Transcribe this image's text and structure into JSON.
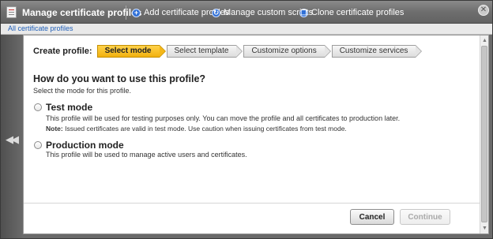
{
  "window": {
    "title": "Manage certificate profiles",
    "actions": [
      {
        "label": "Add certificate profiles",
        "icon": "plus-icon"
      },
      {
        "label": "Manage custom scripts",
        "icon": "refresh-icon"
      },
      {
        "label": "Clone certificate profiles",
        "icon": "copy-icon"
      }
    ]
  },
  "breadcrumb": "All certificate profiles",
  "wizard": {
    "label": "Create profile:",
    "steps": [
      "Select mode",
      "Select template",
      "Customize options",
      "Customize services"
    ],
    "active_step": 0
  },
  "question": "How do you want to use this profile?",
  "subtext": "Select the mode for this profile.",
  "options": [
    {
      "title": "Test mode",
      "description": "This profile will be used for testing purposes only. You can move the profile and all certificates to production later.",
      "note_label": "Note:",
      "note": "Issued certificates are valid in test mode. Use caution when issuing certificates from test mode."
    },
    {
      "title": "Production mode",
      "description": "This profile will be used to manage active users and certificates."
    }
  ],
  "buttons": {
    "cancel": "Cancel",
    "continue": "Continue"
  },
  "colors": {
    "active_step": "#f5b81c",
    "link": "#1f5fb8",
    "action_icon": "#2f6fd6"
  }
}
